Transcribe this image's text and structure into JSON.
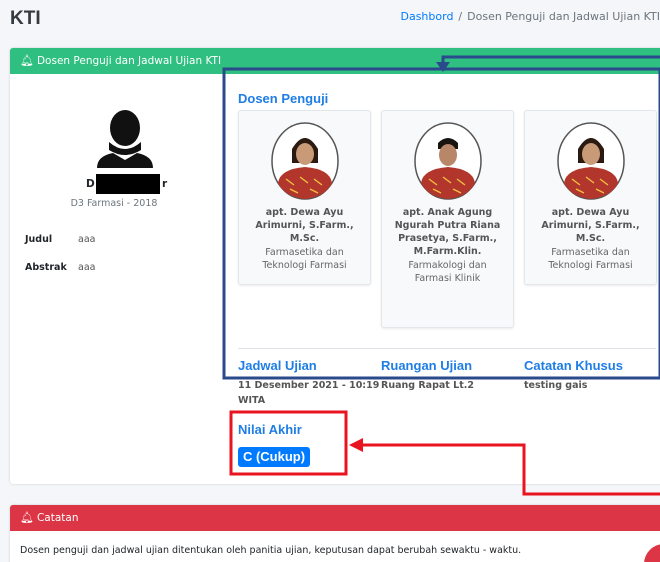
{
  "header": {
    "title": "KTI",
    "breadcrumb": {
      "home": "Dashbord",
      "separator": "/",
      "current": "Dosen Penguji dan Jadwal Ujian KTI"
    }
  },
  "main_card": {
    "header_title": "Dosen Penguji dan Jadwal Ujian KTI",
    "header_icon": "bell-icon",
    "header_color": "#2fbf80"
  },
  "profile": {
    "name_visible_start": "D",
    "name_visible_end": "r",
    "program": "D3 Farmasi - 2018",
    "details": [
      {
        "label": "Judul",
        "value": "aaa"
      },
      {
        "label": "Abstrak",
        "value": "aaa"
      }
    ]
  },
  "examiners": {
    "title": "Dosen Penguji",
    "list": [
      {
        "name": "apt. Dewa Ayu Arimurni, S.Farm., M.Sc.",
        "name_lines": [
          "apt. Dewa Ayu",
          "Arimurni, S.Farm.,",
          "M.Sc."
        ],
        "department_lines": [
          "Farmasetika dan",
          "Teknologi Farmasi"
        ]
      },
      {
        "name": "apt. Anak Agung Ngurah Putra Riana Prasetya, S.Farm., M.Farm.Klin.",
        "name_lines": [
          "apt. Anak Agung",
          "Ngurah Putra Riana",
          "Prasetya, S.Farm.,",
          "M.Farm.Klin."
        ],
        "department_lines": [
          "Farmakologi dan",
          "Farmasi Klinik"
        ]
      },
      {
        "name": "apt. Dewa Ayu Arimurni, S.Farm., M.Sc.",
        "name_lines": [
          "apt. Dewa Ayu",
          "Arimurni, S.Farm.,",
          "M.Sc."
        ],
        "department_lines": [
          "Farmasetika dan",
          "Teknologi Farmasi"
        ]
      }
    ]
  },
  "schedule": {
    "date_title": "Jadwal Ujian",
    "date_lines": [
      "11 Desember 2021 - 10:19",
      "WITA"
    ],
    "room_title": "Ruangan Ujian",
    "room_value": "Ruang Rapat Lt.2",
    "notes_title": "Catatan Khusus",
    "notes_value": "testing gais"
  },
  "grade": {
    "title": "Nilai Akhir",
    "value": "C (Cukup)",
    "badge_color": "#007bff"
  },
  "note_card": {
    "header_title": "Catatan",
    "header_icon": "bell-icon",
    "header_color": "#dc3545",
    "text": "Dosen penguji dan jadwal ujian ditentukan oleh panitia ujian, keputusan dapat berubah sewaktu - waktu."
  },
  "annotations": {
    "blue_color": "#2b4a8c",
    "red_color": "#e8141f"
  }
}
